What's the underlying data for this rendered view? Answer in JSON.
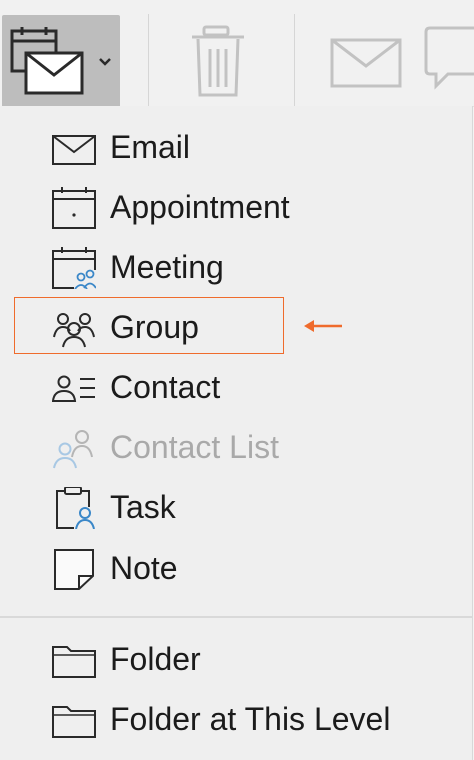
{
  "toolbar": {
    "new_button": {
      "icon": "new-item-icon",
      "dropdown_icon": "chevron-down-icon"
    },
    "delete_icon": "trash-icon",
    "email_icon": "envelope-icon",
    "reply_icon": "speech-bubble-icon"
  },
  "menu": {
    "items": [
      {
        "label": "Email",
        "icon": "envelope-icon",
        "enabled": true
      },
      {
        "label": "Appointment",
        "icon": "calendar-icon",
        "enabled": true
      },
      {
        "label": "Meeting",
        "icon": "calendar-person-icon",
        "enabled": true
      },
      {
        "label": "Group",
        "icon": "group-icon",
        "enabled": true
      },
      {
        "label": "Contact",
        "icon": "contact-card-icon",
        "enabled": true
      },
      {
        "label": "Contact List",
        "icon": "contact-list-icon",
        "enabled": false
      },
      {
        "label": "Task",
        "icon": "clipboard-person-icon",
        "enabled": true
      },
      {
        "label": "Note",
        "icon": "note-icon",
        "enabled": true
      },
      {
        "label": "Folder",
        "icon": "folder-icon",
        "enabled": true
      },
      {
        "label": "Folder at This Level",
        "icon": "folder-icon",
        "enabled": true
      }
    ]
  },
  "annotation": {
    "highlight_color": "#ef6b2c",
    "highlighted_item": "Group"
  },
  "colors": {
    "text": "#1b1b1b",
    "disabled_text": "#a9a9a9",
    "accent_blue": "#3a87c8"
  }
}
